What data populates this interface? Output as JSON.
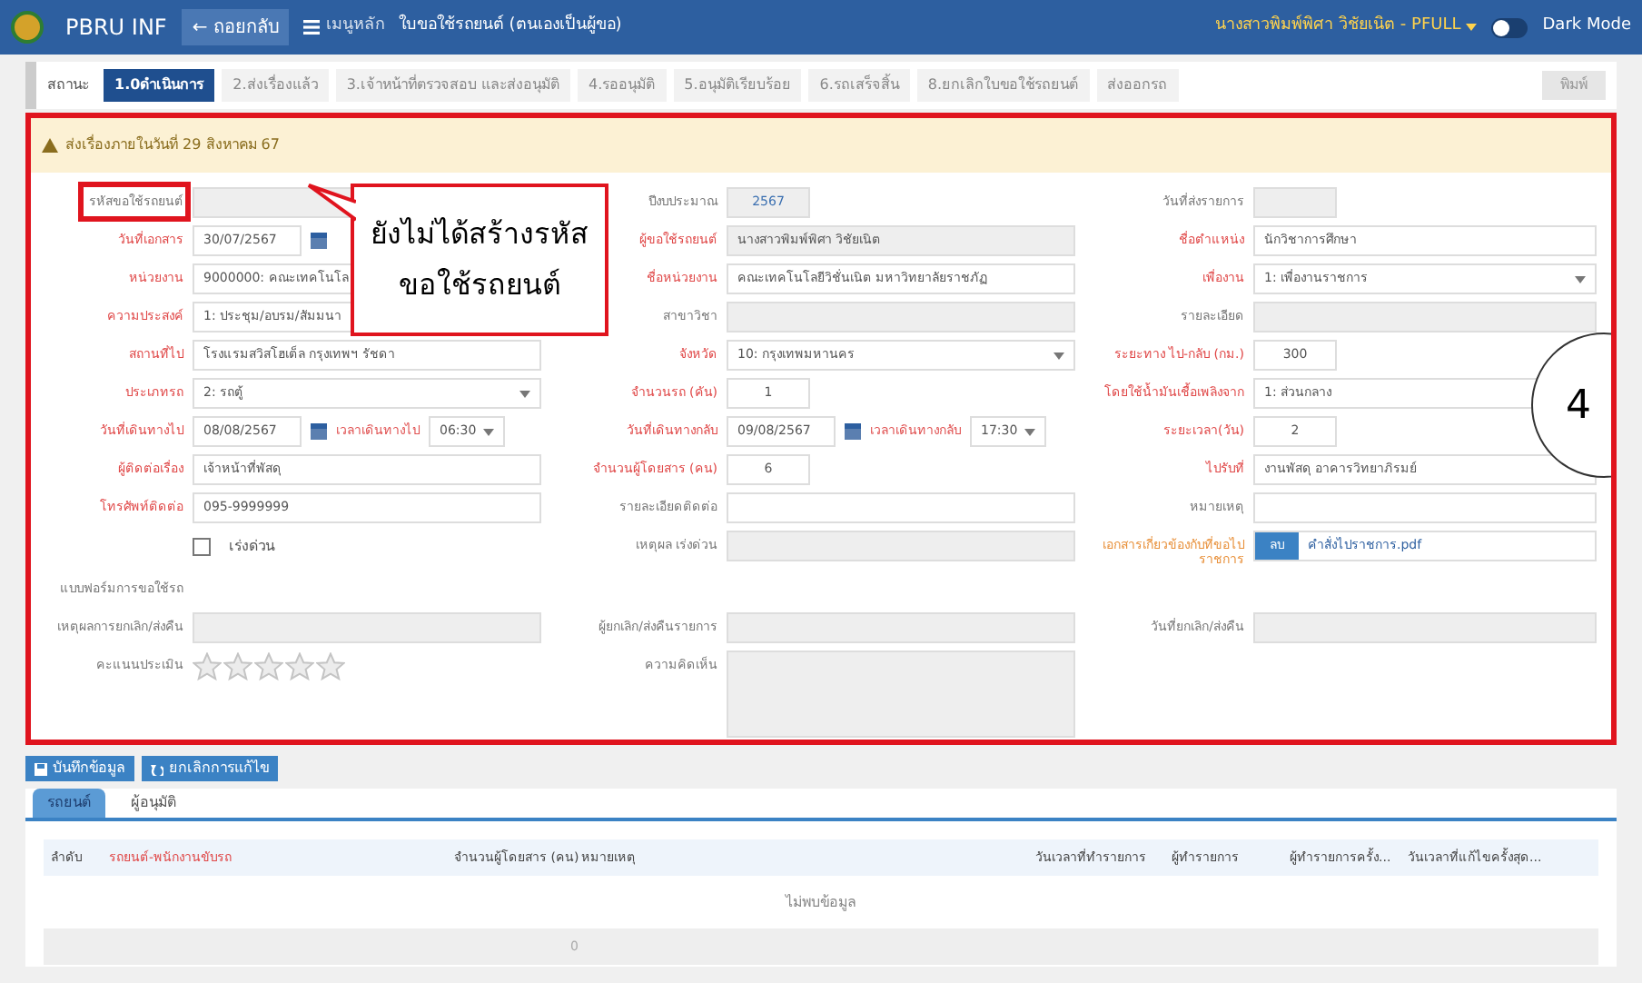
{
  "topbar": {
    "app_name": "PBRU INF",
    "back_button": "← ถอยกลับ",
    "menu_link": "เมนูหลัก",
    "page_title": "ใบขอใช้รถยนต์ (ตนเองเป็นผู้ขอ)",
    "user": "นางสาวพิมพ์พิศา วิชัยเนิต - PFULL",
    "dark_mode": {
      "label": "Dark Mode",
      "on": false
    }
  },
  "status": {
    "label": "สถานะ",
    "steps": [
      {
        "label": "1.0ดำเนินการ",
        "selected": true
      },
      {
        "label": "2.ส่งเรื่องแล้ว",
        "selected": false
      },
      {
        "label": "3.เจ้าหน้าที่ตรวจสอบ และส่งอนุมัติ",
        "selected": false
      },
      {
        "label": "4.รออนุมัติ",
        "selected": false
      },
      {
        "label": "5.อนุมัติเรียบร้อย",
        "selected": false
      },
      {
        "label": "6.รถเสร็จสิ้น",
        "selected": false
      },
      {
        "label": "8.ยกเลิกใบขอใช้รถยนต์",
        "selected": false
      },
      {
        "label": "ส่งออกรถ",
        "selected": false
      }
    ],
    "print_button": {
      "label": "พิมพ์",
      "disabled": true
    }
  },
  "alert": "ส่งเรื่องภายในวันที่ 29 สิงหาคม 67",
  "form_rows": [
    [
      {
        "label": "รหัสขอใช้รถยนต์",
        "color": "#777777",
        "field": {
          "kind": "text",
          "readonly": true
        }
      },
      {
        "label": "ปีงบประมาณ",
        "color": "#777777",
        "field": {
          "kind": "number",
          "value": "2567",
          "readonly": true
        }
      },
      {
        "label": "วันที่ส่งรายการ",
        "color": "#777777",
        "field": {
          "kind": "number",
          "readonly": true
        }
      }
    ],
    [
      {
        "label": "วันที่เอกสาร",
        "color": "#e04848",
        "field": {
          "kind": "date",
          "value": "30/07/2567"
        }
      },
      {
        "label": "ผู้ขอใช้รถยนต์",
        "color": "#e04848",
        "field": {
          "kind": "text",
          "value": "นางสาวพิมพ์พิศา วิชัยเนิต",
          "readonly": true
        }
      },
      {
        "label": "ชื่อตำแหน่ง",
        "color": "#e04848",
        "field": {
          "kind": "text",
          "value": "นักวิชาการศึกษา",
          "readonly": false
        }
      }
    ],
    [
      {
        "label": "หน่วยงาน",
        "color": "#e04848",
        "field": {
          "kind": "text",
          "value": "9000000: คณะเทคโนโล",
          "readonly": false
        }
      },
      {
        "label": "ชื่อหน่วยงาน",
        "color": "#e04848",
        "field": {
          "kind": "text",
          "value": "คณะเทคโนโลยีวิชั่นเนิต มหาวิทยาลัยราชภัฏ",
          "readonly": false
        }
      },
      {
        "label": "เพื่องาน",
        "color": "#e04848",
        "field": {
          "kind": "select",
          "value": "1: เพื่องานราชการ"
        }
      }
    ],
    [
      {
        "label": "ความประสงค์",
        "color": "#e04848",
        "field": {
          "kind": "text",
          "value": "1: ประชุม/อบรม/สัมมนา",
          "readonly": false
        }
      },
      {
        "label": "สาขาวิชา",
        "color": "#777777",
        "field": {
          "kind": "text",
          "readonly": true
        }
      },
      {
        "label": "รายละเอียด",
        "color": "#777777",
        "field": {
          "kind": "text",
          "readonly": true
        }
      }
    ],
    [
      {
        "label": "สถานที่ไป",
        "color": "#e04848",
        "field": {
          "kind": "text",
          "value": "โรงแรมสวิสโฮเต็ล กรุงเทพฯ รัชดา",
          "readonly": false
        }
      },
      {
        "label": "จังหวัด",
        "color": "#e04848",
        "field": {
          "kind": "select",
          "value": "10: กรุงเทพมหานคร"
        }
      },
      {
        "label": "ระยะทาง ไป-กลับ (กม.)",
        "color": "#e04848",
        "field": {
          "kind": "number",
          "value": "300",
          "readonly": false
        }
      }
    ],
    [
      {
        "label": "ประเภทรถ",
        "color": "#e04848",
        "field": {
          "kind": "select",
          "value": "2: รถตู้"
        }
      },
      {
        "label": "จำนวนรถ (คัน)",
        "color": "#e04848",
        "field": {
          "kind": "number",
          "value": "1",
          "readonly": false
        }
      },
      {
        "label": "โดยใช้น้ำมันเชื้อเพลิงจาก",
        "color": "#e04848",
        "field": {
          "kind": "text",
          "value": "1: ส่วนกลาง",
          "readonly": false
        }
      }
    ],
    [
      {
        "label": "วันที่เดินทางไป",
        "color": "#e04848",
        "field": {
          "kind": "datetime",
          "value": "08/08/2567",
          "time_label": "เวลาเดินทางไป",
          "time": "06:30"
        }
      },
      {
        "label": "วันที่เดินทางกลับ",
        "color": "#e04848",
        "field": {
          "kind": "datetime",
          "value": "09/08/2567",
          "time_label": "เวลาเดินทางกลับ",
          "time": "17:30"
        }
      },
      {
        "label": "ระยะเวลา(วัน)",
        "color": "#e04848",
        "field": {
          "kind": "number",
          "value": "2",
          "readonly": false
        }
      }
    ],
    [
      {
        "label": "ผู้ติดต่อเรื่อง",
        "color": "#e04848",
        "field": {
          "kind": "text",
          "value": "เจ้าหน้าที่พัสดุ",
          "readonly": false
        }
      },
      {
        "label": "จำนวนผู้โดยสาร (คน)",
        "color": "#e04848",
        "field": {
          "kind": "number",
          "value": "6",
          "readonly": false
        }
      },
      {
        "label": "ไปรับที่",
        "color": "#e04848",
        "field": {
          "kind": "text",
          "value": "งานพัสดุ อาคารวิทยาภิรมย์",
          "readonly": false
        }
      }
    ],
    [
      {
        "label": "โทรศัพท์ติดต่อ",
        "color": "#e04848",
        "field": {
          "kind": "text",
          "value": "095-9999999",
          "readonly": false
        }
      },
      {
        "label": "รายละเอียดติดต่อ",
        "color": "#777777",
        "field": {
          "kind": "text",
          "readonly": false
        }
      },
      {
        "label": "หมายเหตุ",
        "color": "#777777",
        "field": {
          "kind": "text",
          "readonly": false
        }
      }
    ],
    [
      {
        "field": {
          "kind": "checkbox",
          "text": "เร่งด่วน",
          "checked": false
        }
      },
      {
        "label": "เหตุผล เร่งด่วน",
        "color": "#777777",
        "field": {
          "kind": "text",
          "readonly": true
        }
      },
      {
        "label": "เอกสารเกี่ยวข้องกับที่ขอไปราชการ",
        "color": "#e8903a",
        "field": {
          "kind": "file",
          "button": "ลบ",
          "file": "คำสั่งไปราชการ.pdf"
        }
      }
    ],
    [
      {
        "label": "แบบฟอร์มการขอใช้รถ",
        "color": "#777777",
        "field": {
          "kind": "none"
        }
      }
    ],
    [
      {
        "label": "เหตุผลการยกเลิก/ส่งคืน",
        "color": "#777777",
        "field": {
          "kind": "text",
          "readonly": true
        }
      },
      {
        "label": "ผู้ยกเลิก/ส่งคืนรายการ",
        "color": "#777777",
        "field": {
          "kind": "text",
          "readonly": true
        }
      },
      {
        "label": "วันที่ยกเลิก/ส่งคืน",
        "color": "#777777",
        "field": {
          "kind": "text",
          "readonly": true
        }
      }
    ],
    [
      {
        "label": "คะแนนประเมิน",
        "color": "#777777",
        "field": {
          "kind": "stars",
          "stars": 0
        }
      },
      {
        "label": "ความคิดเห็น",
        "color": "#777777",
        "field": {
          "kind": "textarea",
          "readonly": true
        }
      }
    ]
  ],
  "callout": {
    "lines": [
      "ยังไม่ได้สร้างรหัส",
      "ขอใช้รถยนต์"
    ]
  },
  "side_bubble": {
    "text": "4"
  },
  "actions": [
    {
      "label": "บันทึกข้อมูล",
      "kind": "save"
    },
    {
      "label": "ยกเลิกการแก้ไข",
      "kind": "undo"
    }
  ],
  "tabs": [
    {
      "label": "รถยนต์",
      "selected": true
    },
    {
      "label": "ผู้อนุมัติ",
      "selected": false
    }
  ],
  "table": {
    "columns": [
      {
        "label": "ลำดับ",
        "required": false
      },
      {
        "label": "รถยนต์-พนักงานขับรถ",
        "required": true
      },
      {
        "label": "จำนวนผู้โดยสาร (คน)",
        "required": false
      },
      {
        "label": "หมายเหตุ",
        "required": false
      },
      {
        "label": "วันเวลาที่ทำรายการ",
        "required": false
      },
      {
        "label": "ผู้ทำรายการ",
        "required": false
      },
      {
        "label": "ผู้ทำรายการครั้ง...",
        "required": false
      },
      {
        "label": "วันเวลาที่แก้ไขครั้งสุด...",
        "required": false
      }
    ],
    "empty_text": "ไม่พบข้อมูล",
    "footer": "0"
  }
}
